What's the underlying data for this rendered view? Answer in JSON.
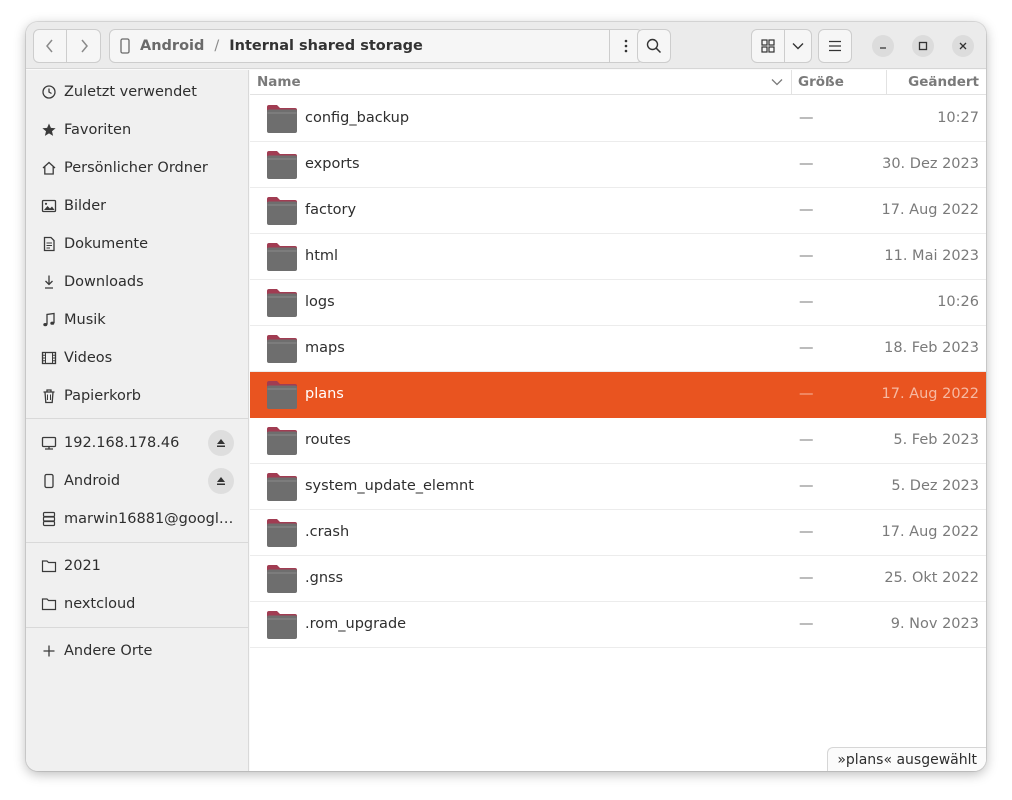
{
  "header": {
    "path": [
      "Android",
      "Internal shared storage"
    ],
    "separator": "/"
  },
  "sidebar": {
    "items": [
      {
        "label": "Zuletzt verwendet",
        "icon": "clock-icon"
      },
      {
        "label": "Favoriten",
        "icon": "star-icon"
      },
      {
        "label": "Persönlicher Ordner",
        "icon": "home-icon"
      },
      {
        "label": "Bilder",
        "icon": "image-icon"
      },
      {
        "label": "Dokumente",
        "icon": "document-icon"
      },
      {
        "label": "Downloads",
        "icon": "download-icon"
      },
      {
        "label": "Musik",
        "icon": "music-icon"
      },
      {
        "label": "Videos",
        "icon": "film-icon"
      },
      {
        "label": "Papierkorb",
        "icon": "trash-icon"
      }
    ],
    "devices": [
      {
        "label": "192.168.178.46",
        "icon": "network-drive-icon",
        "ejectable": true
      },
      {
        "label": "Android",
        "icon": "phone-icon",
        "ejectable": true
      },
      {
        "label": "marwin16881@google...",
        "icon": "server-icon",
        "ejectable": false
      }
    ],
    "bookmarks": [
      {
        "label": "2021",
        "icon": "folder-icon"
      },
      {
        "label": "nextcloud",
        "icon": "folder-icon"
      }
    ],
    "other": {
      "label": "Andere Orte",
      "icon": "plus-icon"
    }
  },
  "columns": {
    "name": "Name",
    "size": "Größe",
    "modified": "Geändert"
  },
  "files": [
    {
      "name": "config_backup",
      "size": "—",
      "modified": "10:27"
    },
    {
      "name": "exports",
      "size": "—",
      "modified": "30. Dez 2023"
    },
    {
      "name": "factory",
      "size": "—",
      "modified": "17. Aug 2022"
    },
    {
      "name": "html",
      "size": "—",
      "modified": "11. Mai 2023"
    },
    {
      "name": "logs",
      "size": "—",
      "modified": "10:26"
    },
    {
      "name": "maps",
      "size": "—",
      "modified": "18. Feb 2023"
    },
    {
      "name": "plans",
      "size": "—",
      "modified": "17. Aug 2022",
      "selected": true
    },
    {
      "name": "routes",
      "size": "—",
      "modified": "5. Feb 2023"
    },
    {
      "name": "system_update_elemnt",
      "size": "—",
      "modified": "5. Dez 2023"
    },
    {
      "name": ".crash",
      "size": "—",
      "modified": "17. Aug 2022"
    },
    {
      "name": ".gnss",
      "size": "—",
      "modified": "25. Okt 2022"
    },
    {
      "name": ".rom_upgrade",
      "size": "—",
      "modified": "9. Nov 2023"
    }
  ],
  "status": "»plans« ausgewählt",
  "colors": {
    "selection": "#e95420",
    "folder_body": "#6e6e6e",
    "folder_tab": "#a13c52"
  }
}
